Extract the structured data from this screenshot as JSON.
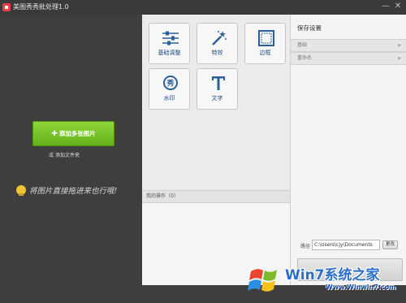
{
  "window": {
    "title": "美图秀秀批处理1.0",
    "minimize_glyph": "—",
    "close_glyph": "✕"
  },
  "left": {
    "add_photos_label": "添加多张图片",
    "or_text": "或",
    "add_folder_label": "添加文件夹",
    "drag_hint": "将图片直接拖进来也行哦!"
  },
  "tools": [
    {
      "id": "basic",
      "label": "基础调整",
      "icon": "sliders-icon"
    },
    {
      "id": "effects",
      "label": "特效",
      "icon": "magic-wand-icon"
    },
    {
      "id": "border",
      "label": "边框",
      "icon": "frame-icon"
    },
    {
      "id": "watermark",
      "label": "水印",
      "icon": "watermark-stamp-icon"
    },
    {
      "id": "text",
      "label": "文字",
      "icon": "text-t-icon"
    }
  ],
  "operations": {
    "header": "我的操作（0）"
  },
  "settings": {
    "title": "保存设置",
    "basic_label": "基础",
    "rename_label": "重命名",
    "path_label": "路径",
    "path_value": "C:\\Users\\cjy\\Documents",
    "change_label": "更改"
  },
  "watermark": {
    "brand": "Win7系统之家",
    "url": "Www.Winwin7.com"
  },
  "colors": {
    "accent_green": "#6cbd22",
    "tool_label_blue": "#1f4f80",
    "dark_bg": "#3e3e3e"
  }
}
